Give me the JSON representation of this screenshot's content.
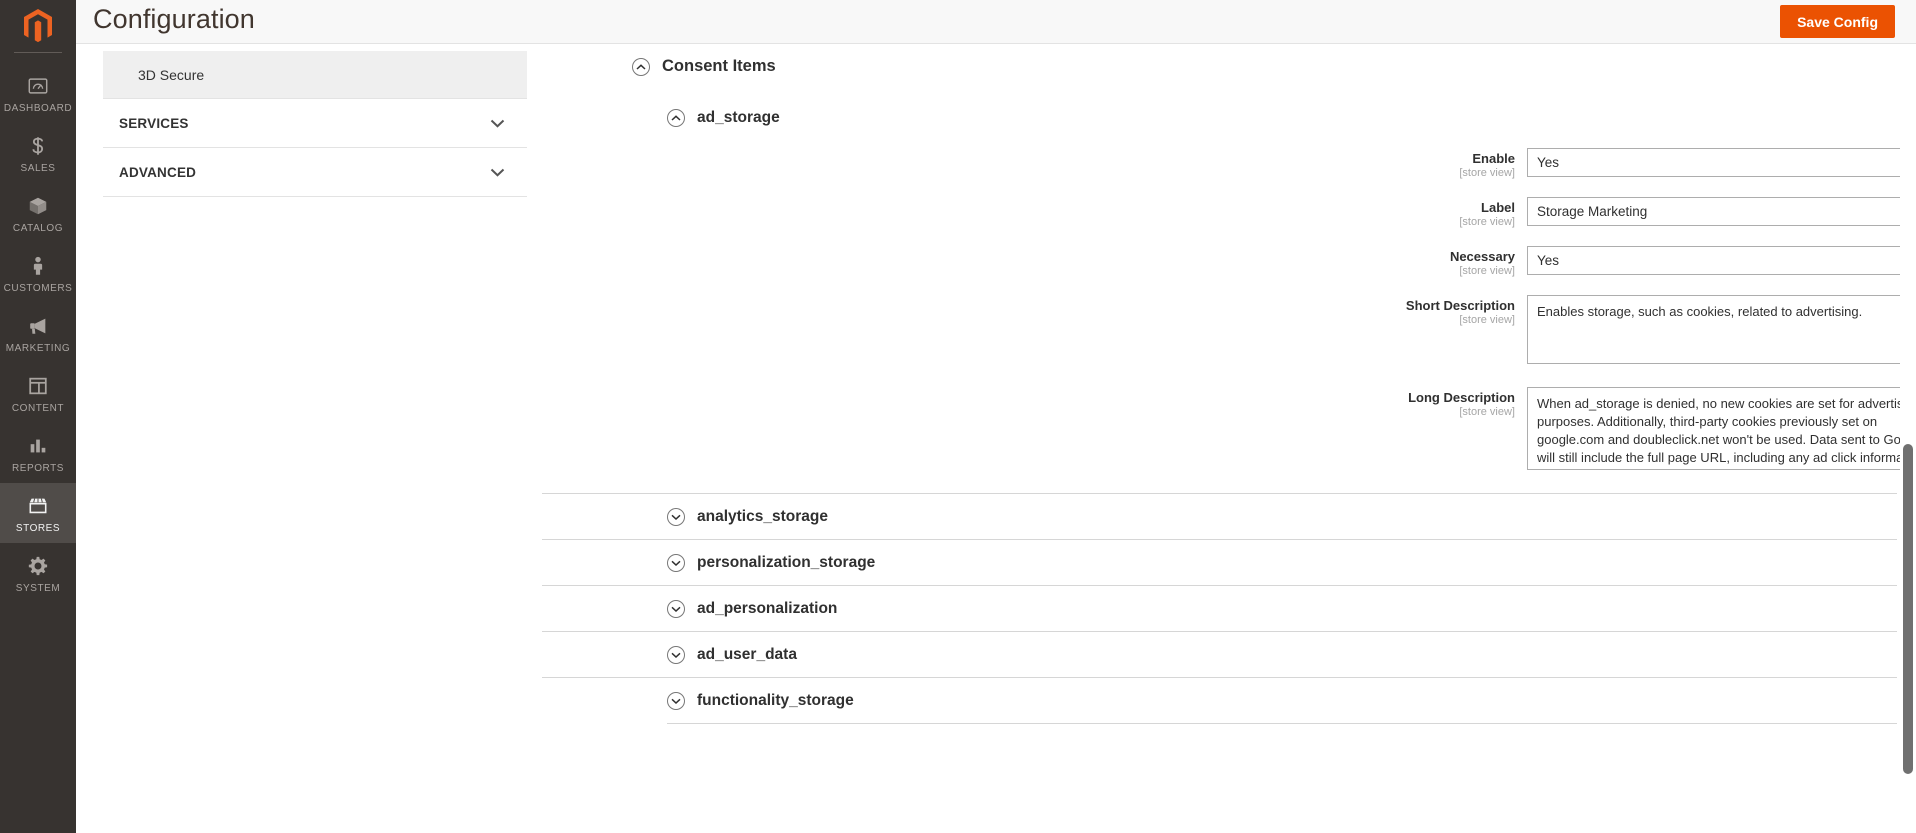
{
  "header": {
    "title": "Configuration",
    "save_label": "Save Config",
    "logo_icon": "magento-logo-icon",
    "accent_color": "#eb5202"
  },
  "rail": {
    "items": [
      {
        "label": "Dashboard",
        "icon": "dashboard-gauge-icon",
        "active": false
      },
      {
        "label": "Sales",
        "icon": "dollar-sign-icon",
        "active": false
      },
      {
        "label": "Catalog",
        "icon": "box-icon",
        "active": false
      },
      {
        "label": "Customers",
        "icon": "person-icon",
        "active": false
      },
      {
        "label": "Marketing",
        "icon": "megaphone-icon",
        "active": false
      },
      {
        "label": "Content",
        "icon": "layout-panels-icon",
        "active": false
      },
      {
        "label": "Reports",
        "icon": "bar-chart-icon",
        "active": false
      },
      {
        "label": "Stores",
        "icon": "storefront-icon",
        "active": true
      },
      {
        "label": "System",
        "icon": "gear-icon",
        "active": false
      }
    ]
  },
  "config_nav": {
    "leaf_item": "3D Secure",
    "groups": [
      {
        "label": "SERVICES",
        "chevron": "chevron-down-icon"
      },
      {
        "label": "ADVANCED",
        "chevron": "chevron-down-icon"
      }
    ]
  },
  "main": {
    "section": {
      "title": "Consent Items",
      "toggle_icon": "circle-chevron-up-icon"
    },
    "subsection": {
      "title": "ad_storage",
      "toggle_icon": "circle-chevron-up-icon"
    },
    "scope_note": "[store view]",
    "fields": [
      {
        "label": "Enable",
        "scope": "[store view]",
        "type": "select",
        "value": "Yes"
      },
      {
        "label": "Label",
        "scope": "[store view]",
        "type": "text",
        "value": "Storage Marketing"
      },
      {
        "label": "Necessary",
        "scope": "[store view]",
        "type": "select",
        "value": "Yes"
      },
      {
        "label": "Short Description",
        "scope": "[store view]",
        "type": "textarea",
        "value": "Enables storage, such as cookies, related to advertising."
      },
      {
        "label": "Long Description",
        "scope": "[store view]",
        "type": "textarea",
        "value": "When ad_storage is denied, no new cookies are set for advertising purposes. Additionally, third-party cookies previously set on google.com and doubleclick.net won't be used. Data sent to Google will still include the full page URL, including any ad click information in the URL parameters."
      }
    ],
    "collapsed_items": [
      {
        "title": "analytics_storage",
        "toggle_icon": "circle-chevron-down-icon"
      },
      {
        "title": "personalization_storage",
        "toggle_icon": "circle-chevron-down-icon"
      },
      {
        "title": "ad_personalization",
        "toggle_icon": "circle-chevron-down-icon"
      },
      {
        "title": "ad_user_data",
        "toggle_icon": "circle-chevron-down-icon"
      },
      {
        "title": "functionality_storage",
        "toggle_icon": "circle-chevron-down-icon"
      }
    ]
  }
}
